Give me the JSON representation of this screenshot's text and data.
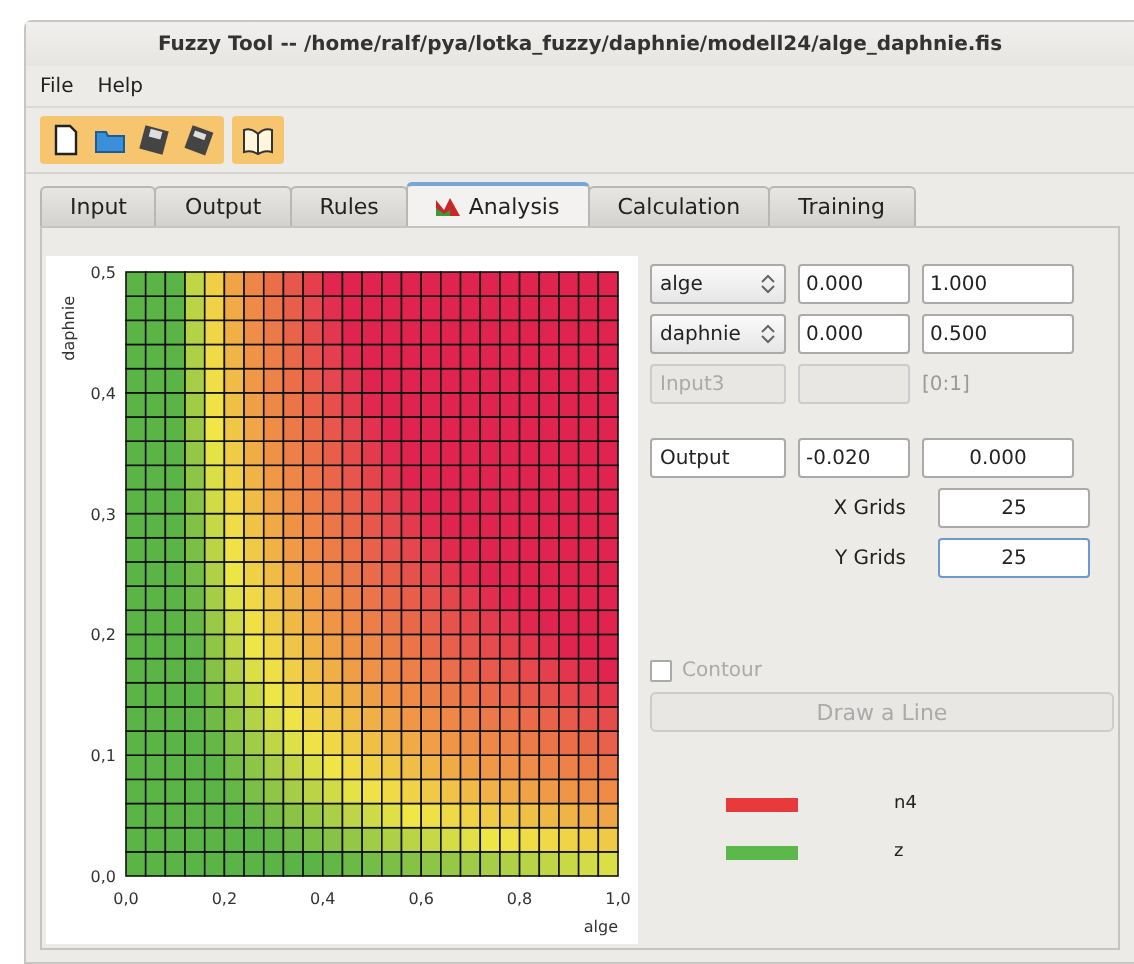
{
  "window": {
    "title": "Fuzzy Tool -- /home/ralf/pya/lotka_fuzzy/daphnie/modell24/alge_daphnie.fis"
  },
  "menu": [
    "File",
    "Help"
  ],
  "tabs": [
    {
      "label": "Input",
      "selected": false,
      "icon": false
    },
    {
      "label": "Output",
      "selected": false,
      "icon": false
    },
    {
      "label": "Rules",
      "selected": false,
      "icon": false
    },
    {
      "label": "Analysis",
      "selected": true,
      "icon": true
    },
    {
      "label": "Calculation",
      "selected": false,
      "icon": false
    },
    {
      "label": "Training",
      "selected": false,
      "icon": false
    }
  ],
  "plot": {
    "xlabel": "alge",
    "ylabel": "daphnie",
    "xticks": [
      "0,0",
      "0,2",
      "0,4",
      "0,6",
      "0,8",
      "1,0"
    ],
    "yticks": [
      "0,5",
      "0,4",
      "0,3",
      "0,2",
      "0,1",
      "0,0"
    ]
  },
  "inputs": [
    {
      "kind": "select",
      "name": "alge",
      "disabled": false,
      "min": "0.000",
      "max": "1.000"
    },
    {
      "kind": "select",
      "name": "daphnie",
      "disabled": false,
      "min": "0.000",
      "max": "0.500"
    },
    {
      "kind": "range",
      "name": "Input3",
      "disabled": true,
      "range": "[0:1]"
    }
  ],
  "output": {
    "name": "Output",
    "min": "-0.020",
    "max": "0.000"
  },
  "grids": [
    {
      "label": "X Grids",
      "value": "25",
      "focused": false
    },
    {
      "label": "Y Grids",
      "value": "25",
      "focused": true
    }
  ],
  "contour": {
    "label": "Contour",
    "checked": false,
    "disabled": true
  },
  "draw_button": {
    "label": "Draw a Line",
    "disabled": true
  },
  "legend": [
    {
      "label": "n4",
      "color": "#e83a3a"
    },
    {
      "label": "z",
      "color": "#5cb84a"
    }
  ]
}
